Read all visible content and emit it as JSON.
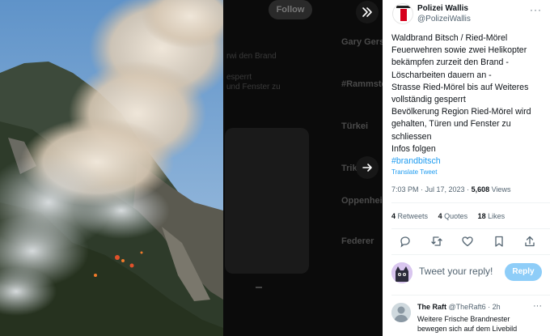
{
  "timeline": {
    "follow_label": "Follow",
    "ghost_lines": [
      "Gary Gerst",
      "#Rammstei",
      "Türkei",
      "Trik",
      "Oppenheim",
      "Federer",
      "rwi den Brand",
      "esperrt",
      "und Fenster zu"
    ]
  },
  "tweet": {
    "author_name": "Polizei Wallis",
    "author_handle": "@PolizeiWallis",
    "more_label": "···",
    "lines": [
      "Waldbrand Bitsch / Ried-Mörel",
      "Feuerwehren sowie zwei Helikopter",
      "bekämpfen zurzeit den Brand -",
      "Löscharbeiten dauern an -",
      "Strasse Ried-Mörel bis auf Weiteres",
      "vollständig gesperrt",
      "Bevölkerung Region Ried-Mörel wird",
      "gehalten, Türen und Fenster zu",
      "schliessen",
      "Infos folgen"
    ],
    "hashtag": "#brandbitsch",
    "translate_label": "Translate Tweet",
    "time": "7:03 PM · Jul 17, 2023 · ",
    "views_count": "5,608",
    "views_label": " Views",
    "retweets_count": "4",
    "retweets_label": " Retweets",
    "quotes_count": "4",
    "quotes_label": " Quotes",
    "likes_count": "18",
    "likes_label": " Likes"
  },
  "composer": {
    "placeholder": "Tweet your reply!",
    "reply_button": "Reply"
  },
  "reply": {
    "name": "The Raft",
    "handle": "@TheRaft6",
    "age": " · 2h",
    "more_label": "···",
    "lines": [
      "Weitere Frische Brandnester",
      "bewegen sich auf dem Livebild"
    ]
  },
  "colors": {
    "link": "#1d9bf0",
    "reply_button": "#8ecdf8",
    "secondary_text": "#536471"
  }
}
